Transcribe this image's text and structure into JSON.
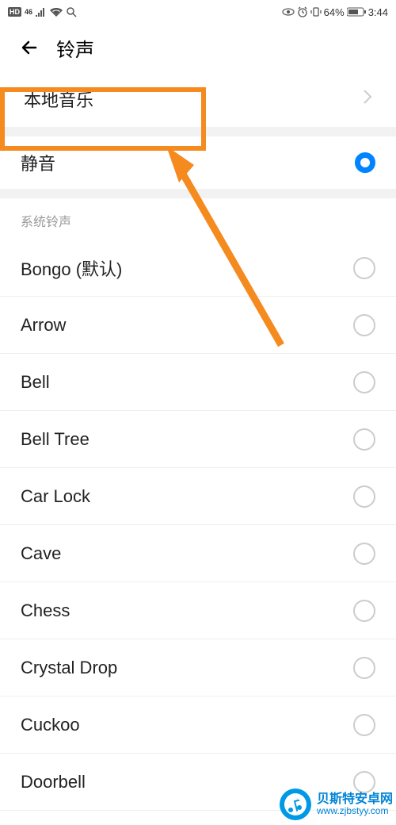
{
  "status": {
    "hd": "HD",
    "lte": "46",
    "battery_text": "64%",
    "time": "3:44"
  },
  "header": {
    "title": "铃声"
  },
  "local_music": {
    "label": "本地音乐"
  },
  "silent": {
    "label": "静音",
    "selected": true
  },
  "section": {
    "title": "系统铃声"
  },
  "ringtones": [
    {
      "label": "Bongo (默认)"
    },
    {
      "label": "Arrow"
    },
    {
      "label": "Bell"
    },
    {
      "label": "Bell Tree"
    },
    {
      "label": "Car Lock"
    },
    {
      "label": "Cave"
    },
    {
      "label": "Chess"
    },
    {
      "label": "Crystal Drop"
    },
    {
      "label": "Cuckoo"
    },
    {
      "label": "Doorbell"
    }
  ],
  "watermark": {
    "title": "贝斯特安卓网",
    "url": "www.zjbstyy.com"
  }
}
